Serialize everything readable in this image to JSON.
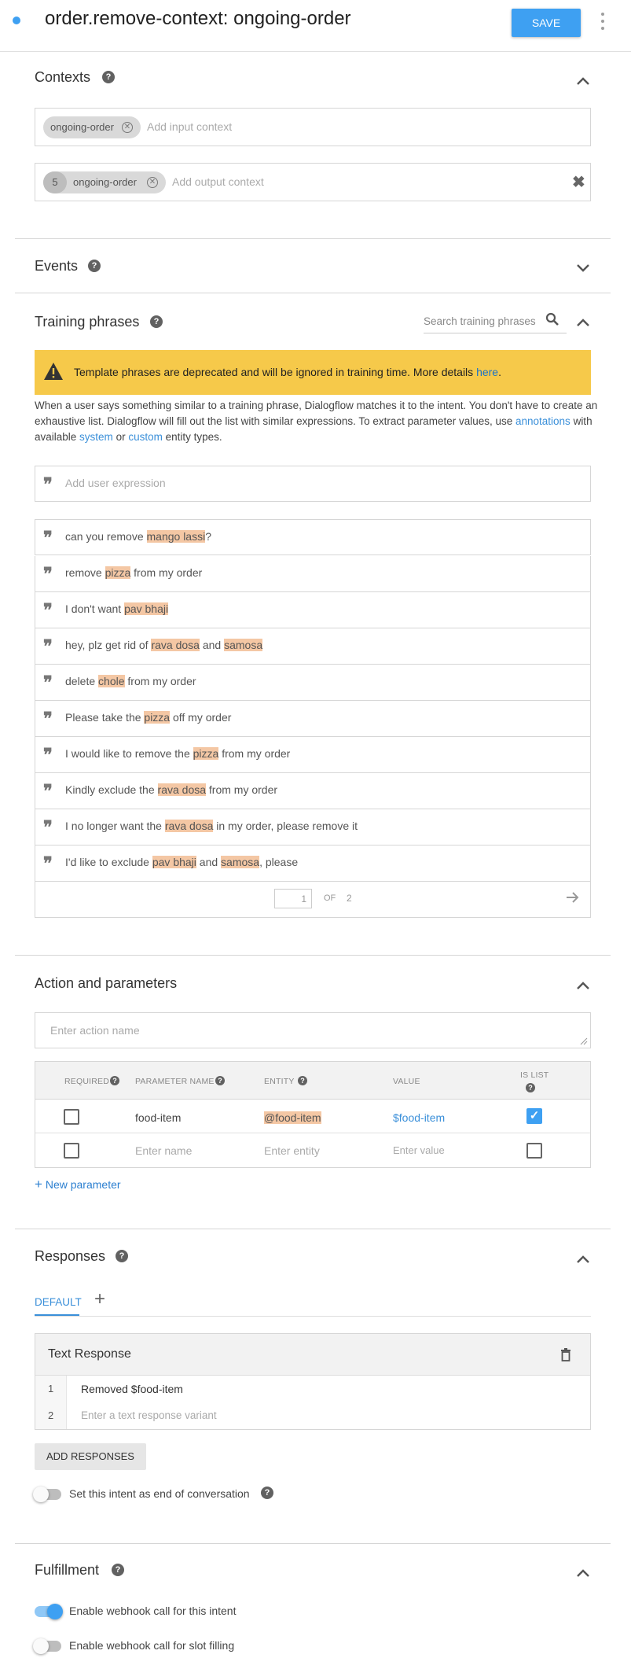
{
  "header": {
    "title": "order.remove-context: ongoing-order",
    "save_label": "SAVE"
  },
  "contexts": {
    "title": "Contexts",
    "input_chip": "ongoing-order",
    "input_placeholder": "Add input context",
    "output_lifespan": "5",
    "output_chip": "ongoing-order",
    "output_placeholder": "Add output context"
  },
  "events": {
    "title": "Events"
  },
  "training": {
    "title": "Training phrases",
    "search_placeholder": "Search training phrases",
    "warning_text": "Template phrases are deprecated and will be ignored in training time. More details ",
    "warning_link": "here",
    "warning_end": ".",
    "desc_1": "When a user says something similar to a training phrase, Dialogflow matches it to the intent. You don't have to create an exhaustive list. Dialogflow will fill out the list with similar expressions. To extract parameter values, use ",
    "desc_link_annotations": "annotations",
    "desc_2": " with available ",
    "desc_link_system": "system",
    "desc_3": " or ",
    "desc_link_custom": "custom",
    "desc_4": " entity types.",
    "add_placeholder": "Add user expression",
    "phrases": [
      [
        {
          "t": "can you remove "
        },
        {
          "t": "mango lassi",
          "h": true
        },
        {
          "t": "?"
        }
      ],
      [
        {
          "t": "remove "
        },
        {
          "t": "pizza",
          "h": true
        },
        {
          "t": " from my order"
        }
      ],
      [
        {
          "t": "I don't want "
        },
        {
          "t": "pav bhaji",
          "h": true
        }
      ],
      [
        {
          "t": "hey, plz get rid of "
        },
        {
          "t": "rava dosa",
          "h": true
        },
        {
          "t": " and "
        },
        {
          "t": "samosa",
          "h": true
        }
      ],
      [
        {
          "t": "delete "
        },
        {
          "t": "chole",
          "h": true
        },
        {
          "t": " from my order"
        }
      ],
      [
        {
          "t": "Please take the "
        },
        {
          "t": "pizza",
          "h": true
        },
        {
          "t": " off my order"
        }
      ],
      [
        {
          "t": "I would like to remove the "
        },
        {
          "t": "pizza",
          "h": true
        },
        {
          "t": " from my order"
        }
      ],
      [
        {
          "t": "Kindly exclude the "
        },
        {
          "t": "rava dosa",
          "h": true
        },
        {
          "t": " from my order"
        }
      ],
      [
        {
          "t": "I no longer want the "
        },
        {
          "t": "rava dosa",
          "h": true
        },
        {
          "t": " in my order, please remove it"
        }
      ],
      [
        {
          "t": "I'd like to exclude "
        },
        {
          "t": "pav bhaji",
          "h": true
        },
        {
          "t": " and "
        },
        {
          "t": "samosa",
          "h": true
        },
        {
          "t": ", please"
        }
      ]
    ],
    "page_current": "1",
    "page_of": "OF",
    "page_total": "2"
  },
  "action": {
    "title": "Action and parameters",
    "action_placeholder": "Enter action name",
    "headers": {
      "required": "REQUIRED",
      "name": "PARAMETER NAME",
      "entity": "ENTITY",
      "value": "VALUE",
      "is_list": "IS LIST"
    },
    "row": {
      "required": false,
      "name": "food-item",
      "entity": "@food-item",
      "value": "$food-item",
      "is_list": true
    },
    "empty_row": {
      "name_placeholder": "Enter name",
      "entity_placeholder": "Enter entity",
      "value_placeholder": "Enter value"
    },
    "new_param": "New parameter"
  },
  "responses": {
    "title": "Responses",
    "tab_default": "DEFAULT",
    "card_title": "Text Response",
    "line1_num": "1",
    "line1_text": "Removed $food-item",
    "line2_num": "2",
    "line2_placeholder": "Enter a text response variant",
    "add_button": "ADD RESPONSES",
    "end_conversation": "Set this intent as end of conversation",
    "end_conversation_on": false
  },
  "fulfillment": {
    "title": "Fulfillment",
    "webhook_label": "Enable webhook call for this intent",
    "webhook_on": true,
    "slot_label": "Enable webhook call for slot filling",
    "slot_on": false
  },
  "colors": {
    "accent": "#3ea0f2",
    "warning": "#f6c94a",
    "highlight": "#f4c7a4"
  }
}
